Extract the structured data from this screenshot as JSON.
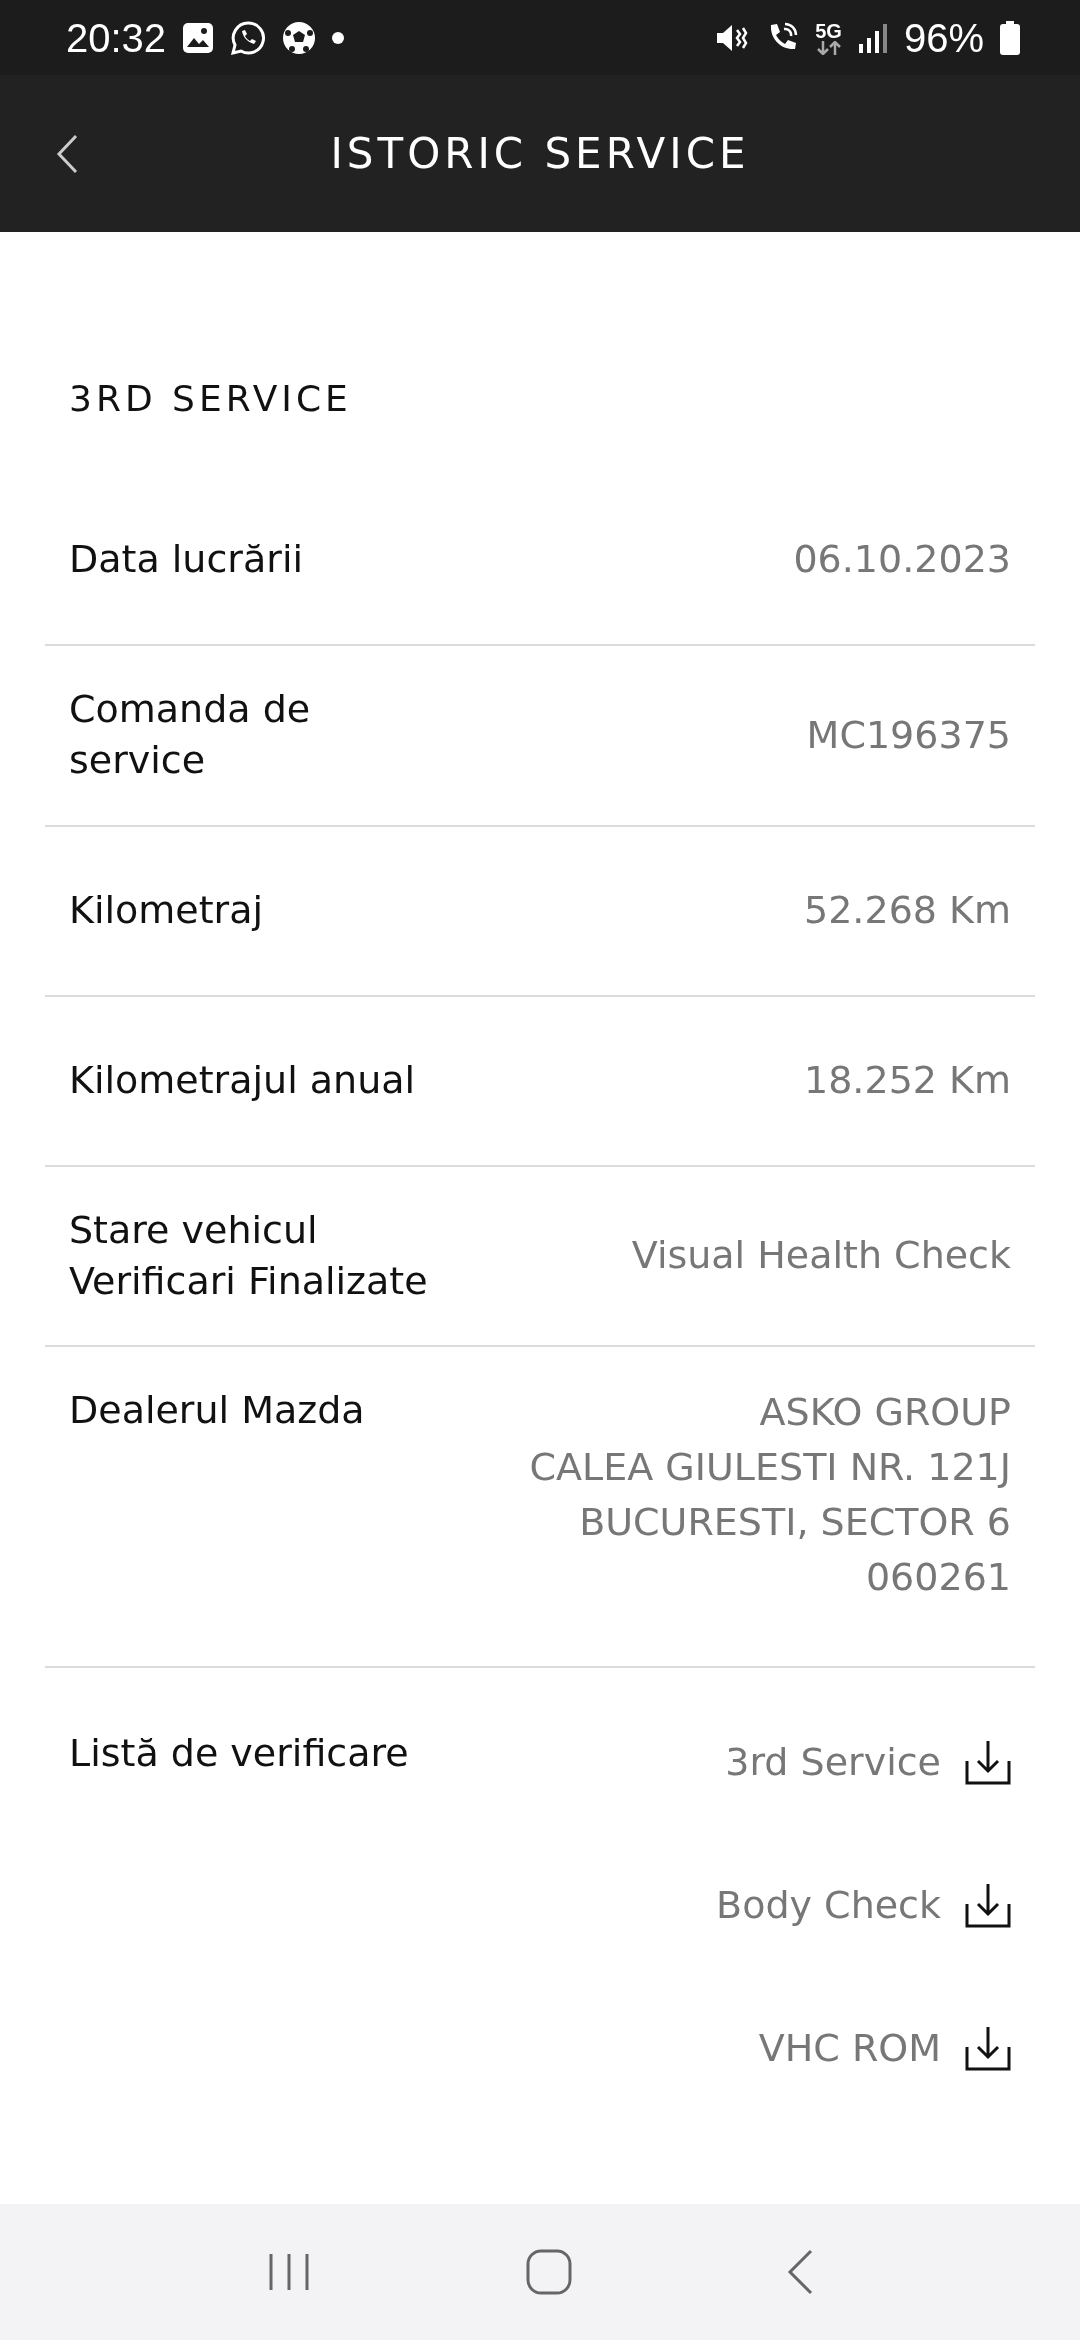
{
  "status_bar": {
    "time": "20:32",
    "battery": "96%",
    "network": "5G"
  },
  "header": {
    "title": "ISTORIC SERVICE"
  },
  "section": {
    "title": "3RD SERVICE"
  },
  "rows": [
    {
      "label": [
        "Data lucrării"
      ],
      "value": [
        "06.10.2023"
      ]
    },
    {
      "label": [
        "Comanda de",
        "service"
      ],
      "value": [
        "MC196375"
      ]
    },
    {
      "label": [
        "Kilometraj"
      ],
      "value": [
        "52.268 Km"
      ]
    },
    {
      "label": [
        "Kilometrajul anual"
      ],
      "value": [
        "18.252 Km"
      ]
    },
    {
      "label": [
        "Stare vehicul",
        "Verificari Finalizate"
      ],
      "value": [
        "Visual Health Check"
      ]
    },
    {
      "label": [
        "Dealerul Mazda"
      ],
      "value": [
        "ASKO GROUP",
        "CALEA GIULESTI NR. 121J",
        "BUCURESTI, SECTOR 6",
        "060261"
      ]
    }
  ],
  "checklist": {
    "label": "Listă de verificare",
    "documents": [
      "3rd Service",
      "Body Check",
      "VHC ROM"
    ]
  }
}
